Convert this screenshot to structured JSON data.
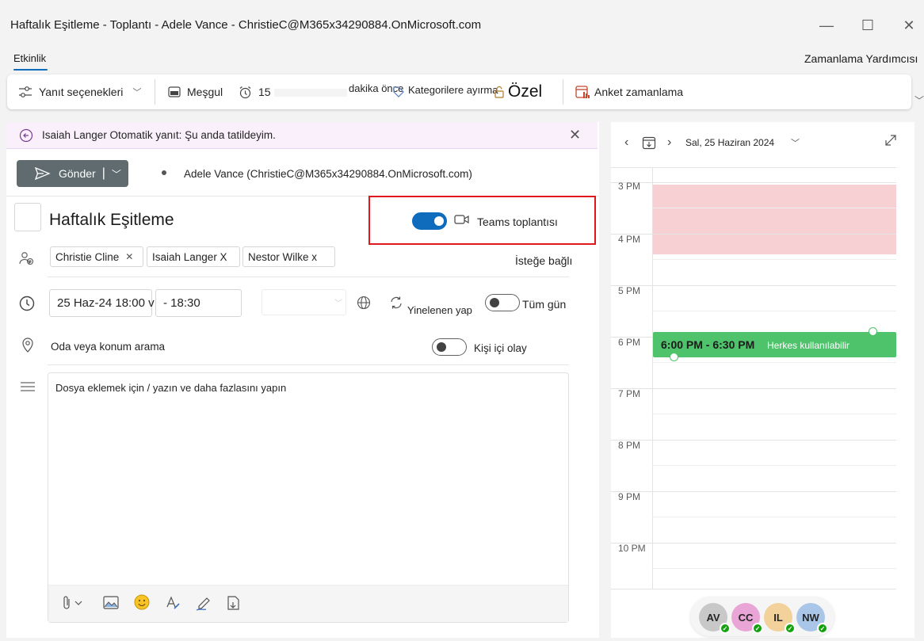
{
  "window": {
    "title": "Haftalık Eşitleme - Toplantı - Adele Vance - ChristieC@M365x34290884.OnMicrosoft.com",
    "minimize_glyph": "—",
    "maximize_glyph": "☐",
    "close_glyph": "✕"
  },
  "tabs": {
    "active": "Etkinlik",
    "scheduling_assistant": "Zamanlama Yardımcısı"
  },
  "toolbar": {
    "response_options": "Yanıt seçenekleri",
    "show_as": "Meşgul",
    "reminder_value": "15",
    "reminder_suffix": "dakika önce",
    "categorize": "Kategorilere ayırma",
    "private": "Özel",
    "poll": "Anket zamanlama"
  },
  "autoreply": {
    "text": "Isaiah Langer Otomatik yanıt: Şu anda tatildeyim."
  },
  "send": {
    "label": "Gönder",
    "from": "Adele Vance (ChristieC@M365x34290884.OnMicrosoft.com)"
  },
  "meeting": {
    "title": "Haftalık Eşitleme",
    "teams_label": "Teams toplantısı",
    "teams_on": true
  },
  "attendees": {
    "chips": [
      {
        "name": "Christie Cline",
        "remove": "✕"
      },
      {
        "name": "Isaiah Langer X",
        "remove": ""
      },
      {
        "name": "Nestor Wilke x",
        "remove": ""
      }
    ],
    "optional_label": "İsteğe bağlı"
  },
  "time": {
    "start": "25 Haz-24 18:00 v",
    "end": "- 18:30",
    "recurring": "Yinelenen yap",
    "all_day": "Tüm gün"
  },
  "location": {
    "placeholder": "Oda veya konum arama",
    "in_person": "Kişi içi olay"
  },
  "body": {
    "placeholder": "Dosya eklemek için / yazın ve daha fazlasını yapın"
  },
  "calendar": {
    "date": "Sal, 25 Haziran 2024",
    "hours": [
      "3 PM",
      "4 PM",
      "5 PM",
      "6 PM",
      "7 PM",
      "8 PM",
      "9 PM",
      "10 PM"
    ],
    "event_time": "6:00 PM - 6:30 PM",
    "event_status": "Herkes kullanılabilir",
    "busy_color": "#f6d0d3",
    "event_color": "#4ec36b"
  },
  "avatars": [
    {
      "initials": "AV",
      "color": "#c8c8c8"
    },
    {
      "initials": "CC",
      "color": "#e9a5d6"
    },
    {
      "initials": "IL",
      "color": "#f2d29a"
    },
    {
      "initials": "NW",
      "color": "#a9c6e8"
    }
  ]
}
